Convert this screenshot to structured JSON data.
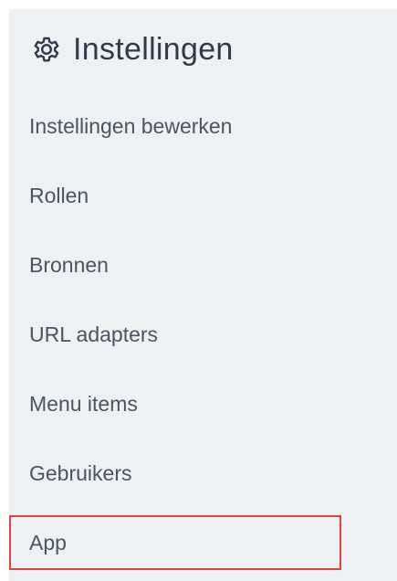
{
  "header": {
    "title": "Instellingen",
    "icon": "gear-icon"
  },
  "menu": {
    "items": [
      {
        "label": "Instellingen bewerken"
      },
      {
        "label": "Rollen"
      },
      {
        "label": "Bronnen"
      },
      {
        "label": "URL adapters"
      },
      {
        "label": "Menu items"
      },
      {
        "label": "Gebruikers"
      },
      {
        "label": "App",
        "highlighted": true
      }
    ]
  },
  "colors": {
    "panel_background": "#edf1f4",
    "text": "#4a5562",
    "heading": "#2f3b4a",
    "highlight_border": "#e0443d"
  }
}
